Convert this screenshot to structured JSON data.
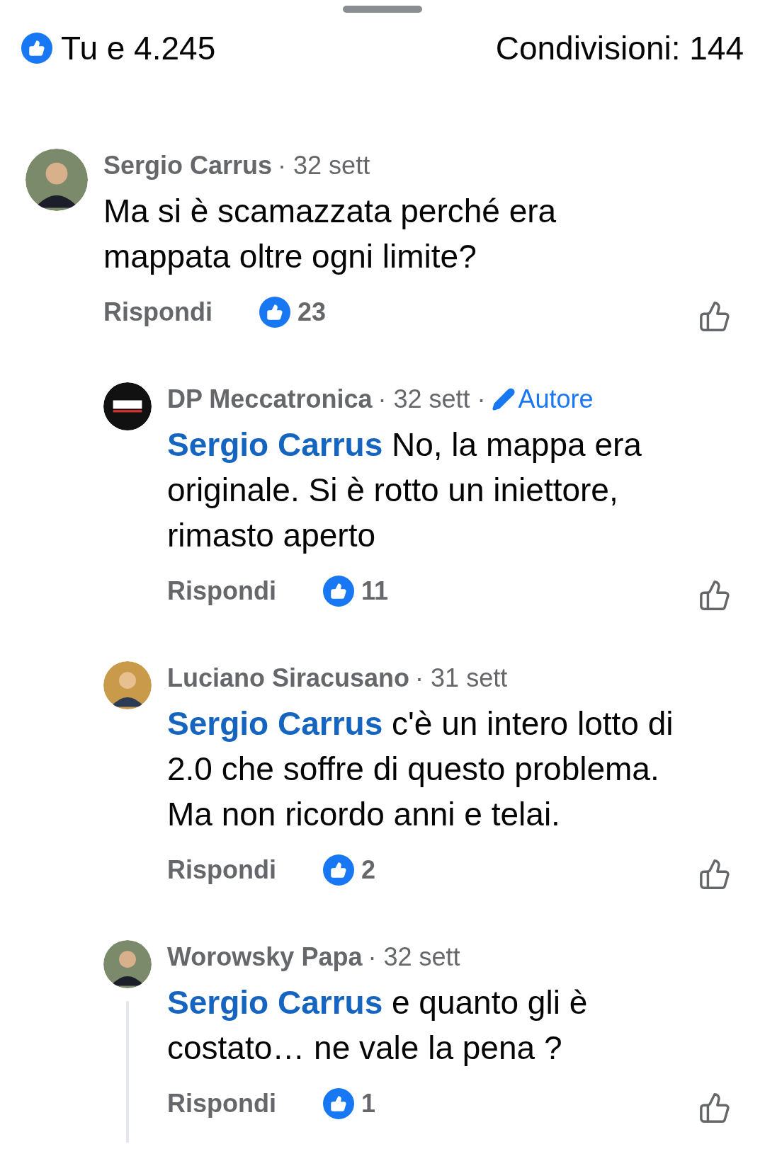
{
  "header": {
    "reactions": "Tu e 4.245",
    "shares": "Condivisioni: 144"
  },
  "comments": [
    {
      "author": "Sergio Carrus",
      "time": "· 32 sett",
      "text": "Ma si è scamazzata perché era mappata oltre ogni limite?",
      "reply": "Rispondi",
      "likes": "23",
      "kind": "man",
      "children": [
        {
          "author": "DP Meccatronica",
          "time": "· 32 sett ·",
          "badge": "Autore",
          "mention": "Sergio Carrus",
          "text": "No, la mappa era originale. Si è rotto un iniettore, rimasto aperto",
          "reply": "Rispondi",
          "likes": "11",
          "kind": "logo",
          "thread_line": false
        },
        {
          "author": "Luciano Siracusano",
          "time": "· 31 sett",
          "mention": "Sergio Carrus",
          "text": "c'è un intero lotto di 2.0 che soffre di questo problema. Ma non ricordo anni e telai.",
          "reply": "Rispondi",
          "likes": "2",
          "kind": "cartoon",
          "thread_line": false
        },
        {
          "author": "Worowsky Papa",
          "time": "· 32 sett",
          "mention": "Sergio Carrus",
          "text": "e quanto gli è costato… ne vale la pena ?",
          "reply": "Rispondi",
          "likes": "1",
          "kind": "man",
          "thread_line": true
        }
      ]
    }
  ]
}
